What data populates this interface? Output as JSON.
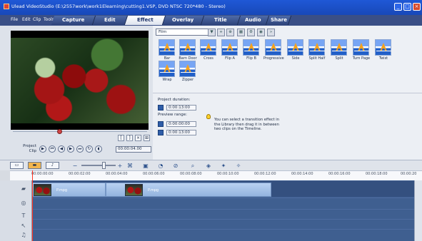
{
  "window": {
    "title": "Ulead VideoStudio (E:\\2557work\\work1Elearning\\cutting1.VSP, DVD NTSC 720*480 - Stereo)",
    "controls": [
      "_",
      "□",
      "×"
    ]
  },
  "menu": [
    "File",
    "Edit",
    "Clip",
    "Tools"
  ],
  "steps": [
    "Capture",
    "Edit",
    "Effect",
    "Overlay",
    "Title",
    "Audio",
    "Share"
  ],
  "preview": {
    "mode_label": "Project\nClip",
    "timecode": "00:00:04.00"
  },
  "library": {
    "category": "Film",
    "transitions": [
      "Bar",
      "Barn Door",
      "Cross",
      "Flip A",
      "Flip B",
      "Progressive",
      "Side",
      "Split Half",
      "Split",
      "Turn Page",
      "Twist",
      "Wrap",
      "Zipper"
    ]
  },
  "options": {
    "project_duration_label": "Project duration:",
    "project_duration": "0:00:13:00",
    "preview_range_label": "Preview range:",
    "preview_start": "0:00:00:00",
    "preview_end": "0:00:13:00",
    "hint": "You can select a transition effect in the Library then drag it in between two clips on the Timeline."
  },
  "timeline": {
    "ruler": [
      "00:00:00:00",
      "00:00:02:00",
      "00:00:04:00",
      "00:00:06:00",
      "00:00:08:00",
      "00:00:10:00",
      "00:00:12:00",
      "00:00:14:00",
      "00:00:16:00",
      "00:00:18:00",
      "00:00:20"
    ],
    "clips": [
      "P.mpg",
      "P.mpg"
    ]
  },
  "colors": {
    "title_blue": "#1f58d6",
    "menu_navy": "#3a4f86",
    "timeline_blue": "#3f5f90",
    "clip_blue": "#a9c7ee"
  }
}
